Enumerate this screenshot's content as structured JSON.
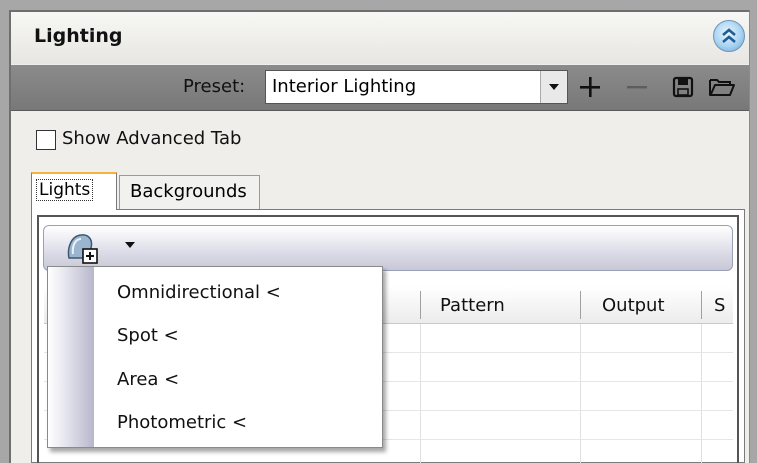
{
  "panel": {
    "title": "Lighting",
    "collapse_icon": "double-chevron-up-icon"
  },
  "preset": {
    "label": "Preset:",
    "value": "Interior Lighting",
    "actions": [
      "add-icon",
      "remove-icon",
      "save-icon",
      "open-folder-icon"
    ]
  },
  "advanced": {
    "label": "Show Advanced Tab",
    "checked": false
  },
  "tabs": {
    "items": [
      {
        "label": "Lights",
        "active": true
      },
      {
        "label": "Backgrounds",
        "active": false
      }
    ]
  },
  "list_toolbar": {
    "create_icon": "light-bulb-create-icon",
    "dropdown_icon": "caret-down-icon"
  },
  "grid": {
    "columns": [
      "Pattern",
      "Output",
      "S"
    ]
  },
  "create_menu": {
    "items": [
      {
        "label": "Omnidirectional <"
      },
      {
        "label": "Spot <"
      },
      {
        "label": "Area <"
      },
      {
        "label": "Photometric <"
      }
    ]
  },
  "colors": {
    "active_tab_accent": "#f2b43a",
    "preset_bar": "#808080",
    "collapse_button": "#a9d3f1"
  }
}
